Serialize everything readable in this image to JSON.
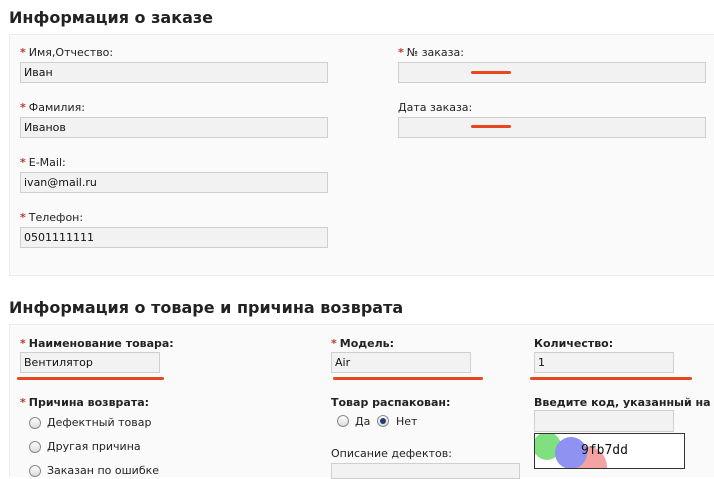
{
  "order_info": {
    "title": "Информация о заказе",
    "first_name": {
      "label": "Имя,Отчество:",
      "value": "Иван"
    },
    "last_name": {
      "label": "Фамилия:",
      "value": "Иванов"
    },
    "email": {
      "label": "E-Mail:",
      "value": "ivan@mail.ru"
    },
    "phone": {
      "label": "Телефон:",
      "value": "0501111111"
    },
    "order_number": {
      "label": "№ заказа:",
      "value": ""
    },
    "order_date": {
      "label": "Дата заказа:",
      "value": ""
    }
  },
  "product_info": {
    "title": "Информация о товаре и причина возврата",
    "product_name": {
      "label": "Наименование товара:",
      "value": "Вентилятор"
    },
    "model": {
      "label": "Модель:",
      "value": "Air"
    },
    "quantity": {
      "label": "Количество:",
      "value": "1"
    },
    "return_reason": {
      "label": "Причина возврата:",
      "options": [
        "Дефектный товар",
        "Другая причина",
        "Заказан по ошибке"
      ]
    },
    "unpacked": {
      "label": "Товар распакован:",
      "yes": "Да",
      "no": "Нет",
      "selected": "no"
    },
    "defect_description": {
      "label": "Описание дефектов:"
    },
    "captcha": {
      "label": "Введите код, указанный на кар",
      "code": "9fb7dd"
    }
  },
  "required_mark": "*",
  "colors": {
    "required": "#c0392b",
    "annotation": "#e8461e"
  }
}
